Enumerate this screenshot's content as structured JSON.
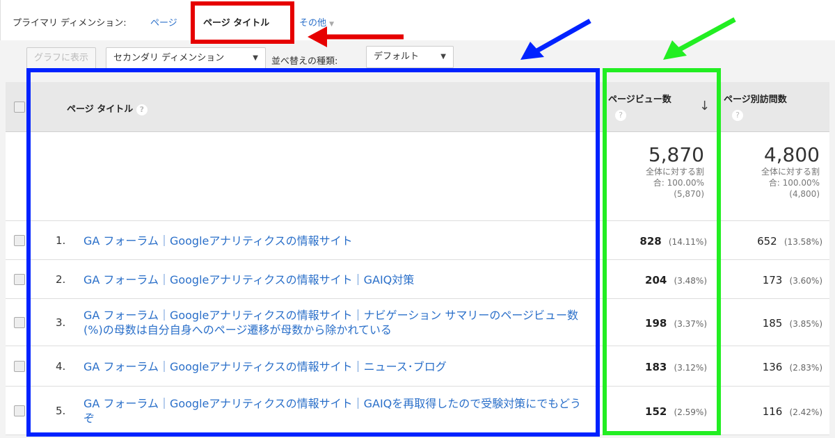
{
  "primary_dimension": {
    "label": "プライマリ ディメンション:",
    "options": [
      "ページ",
      "ページ タイトル",
      "その他"
    ],
    "selected": "ページ タイトル"
  },
  "toolbar": {
    "chart_button": "グラフに表示",
    "secondary_dimension": "セカンダリ ディメンション",
    "sort_label": "並べ替えの種類:",
    "sort_value": "デフォルト"
  },
  "columns": {
    "title": "ページ タイトル",
    "pageviews": "ページビュー数",
    "visits": "ページ別訪問数",
    "help": "?"
  },
  "totals": {
    "pageviews": {
      "value": "5,870",
      "note1": "全体に対する割",
      "note2": "合: 100.00%",
      "note3": "(5,870)"
    },
    "visits": {
      "value": "4,800",
      "note1": "全体に対する割",
      "note2": "合: 100.00%",
      "note3": "(4,800)"
    }
  },
  "rows": [
    {
      "index": "1.",
      "title": "GA フォーラム｜Googleアナリティクスの情報サイト",
      "pv": "828",
      "pv_pct": "(14.11%)",
      "visits": "652",
      "visits_pct": "(13.58%)"
    },
    {
      "index": "2.",
      "title": "GA フォーラム｜Googleアナリティクスの情報サイト｜GAIQ対策",
      "pv": "204",
      "pv_pct": "(3.48%)",
      "visits": "173",
      "visits_pct": "(3.60%)"
    },
    {
      "index": "3.",
      "title": "GA フォーラム｜Googleアナリティクスの情報サイト｜ナビゲーション サマリーのページビュー数(%)の母数は自分自身へのページ遷移が母数から除かれている",
      "pv": "198",
      "pv_pct": "(3.37%)",
      "visits": "185",
      "visits_pct": "(3.85%)"
    },
    {
      "index": "4.",
      "title": "GA フォーラム｜Googleアナリティクスの情報サイト｜ニュース･ブログ",
      "pv": "183",
      "pv_pct": "(3.12%)",
      "visits": "136",
      "visits_pct": "(2.83%)"
    },
    {
      "index": "5.",
      "title": "GA フォーラム｜Googleアナリティクスの情報サイト｜GAIQを再取得したので受験対策にでもどうぞ",
      "pv": "152",
      "pv_pct": "(2.59%)",
      "visits": "116",
      "visits_pct": "(2.42%)"
    }
  ],
  "colors": {
    "red": "#e60000",
    "blue": "#0022ff",
    "green": "#22ee22",
    "link": "#2a6fc9"
  }
}
